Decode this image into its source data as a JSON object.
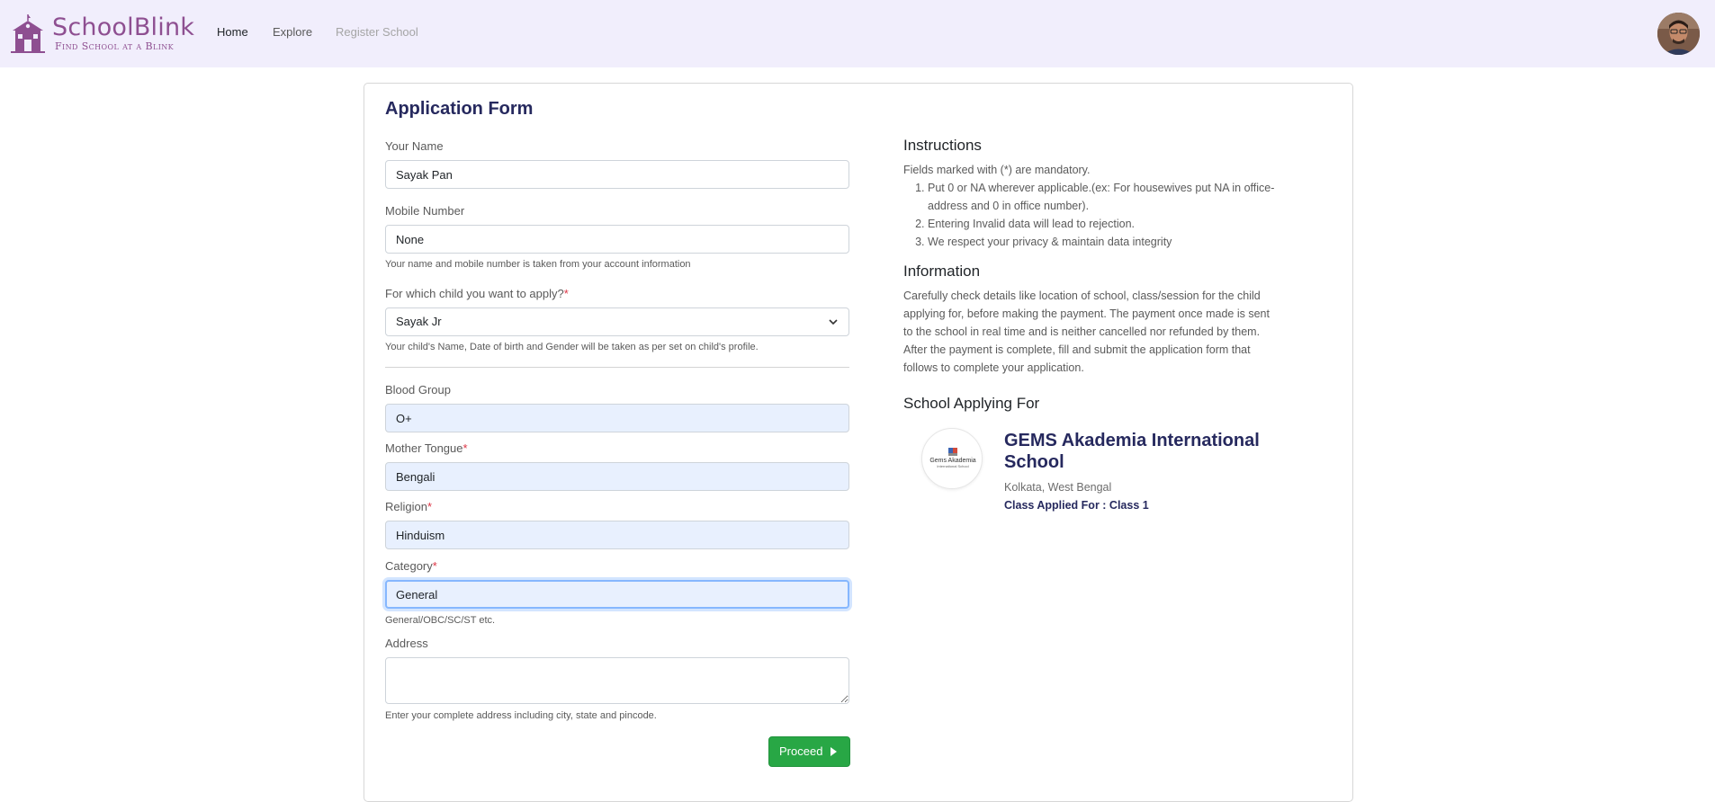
{
  "nav": {
    "brand_name": "SchoolBlink",
    "brand_tagline": "Find School at a Blink",
    "links": [
      "Home",
      "Explore",
      "Register School"
    ]
  },
  "form": {
    "title": "Application Form",
    "name_label": "Your Name",
    "name_value": "Sayak Pan",
    "mobile_label": "Mobile Number",
    "mobile_value": "None",
    "account_help": "Your name and mobile number is taken from your account information",
    "child_label": "For which child you want to apply?",
    "child_value": "Sayak Jr",
    "child_help": "Your child's Name, Date of birth and Gender will be taken as per set on child's profile.",
    "blood_label": "Blood Group",
    "blood_value": "O+",
    "tongue_label": "Mother Tongue",
    "tongue_value": "Bengali",
    "religion_label": "Religion",
    "religion_value": "Hinduism",
    "category_label": "Category",
    "category_value": "General",
    "category_help": "General/OBC/SC/ST etc.",
    "address_label": "Address",
    "address_value": "",
    "address_help": "Enter your complete address including city, state and pincode.",
    "required_marker": "*",
    "proceed_label": "Proceed"
  },
  "instructions": {
    "title": "Instructions",
    "intro": "Fields marked with (*) are mandatory.",
    "items": [
      "Put 0 or NA wherever applicable.(ex: For housewives put NA in office-address and 0 in office number).",
      "Entering Invalid data will lead to rejection.",
      "We respect your privacy & maintain data integrity"
    ]
  },
  "information": {
    "title": "Information",
    "text": "Carefully check details like location of school, class/session for the child applying for, before making the payment. The payment once made is sent to the school in real time and is neither cancelled nor refunded by them. After the payment is complete, fill and submit the application form that follows to complete your application."
  },
  "school": {
    "section_title": "School Applying For",
    "logo_text_line1": "Gems Akademia",
    "logo_text_line2": "International School",
    "name": "GEMS Akademia International School",
    "location": "Kolkata, West Bengal",
    "class_applied": "Class Applied For : Class 1"
  },
  "colors": {
    "navbar_bg": "#f1eefc",
    "brand": "#8e4f91",
    "heading": "#26295e",
    "proceed_green": "#28a745",
    "autofill_bg": "#e8f0fe",
    "required_red": "#dc3545"
  }
}
